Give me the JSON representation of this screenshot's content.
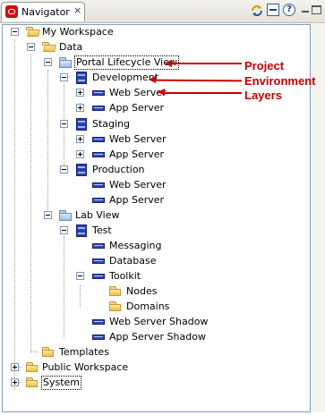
{
  "titlebar": {
    "tab_label": "Navigator",
    "tab_close": "×",
    "help": "?",
    "icons": [
      "navigator-icon",
      "sync-icon",
      "collapse-icon",
      "help-icon",
      "minimize-icon",
      "maximize-icon"
    ]
  },
  "tree": [
    {
      "label": "My Workspace",
      "icon": "folder-open"
    },
    {
      "label": "Data",
      "icon": "folder-open"
    },
    {
      "label": "Portal Lifecycle View",
      "icon": "view-folder"
    },
    {
      "label": "Development",
      "icon": "environment"
    },
    {
      "label": "Web Server",
      "icon": "layer"
    },
    {
      "label": "App Server",
      "icon": "layer"
    },
    {
      "label": "Staging",
      "icon": "environment"
    },
    {
      "label": "Web Server",
      "icon": "layer"
    },
    {
      "label": "App Server",
      "icon": "layer"
    },
    {
      "label": "Production",
      "icon": "environment"
    },
    {
      "label": "Web Server",
      "icon": "layer"
    },
    {
      "label": "App Server",
      "icon": "layer"
    },
    {
      "label": "Lab View",
      "icon": "view-folder"
    },
    {
      "label": "Test",
      "icon": "environment"
    },
    {
      "label": "Messaging",
      "icon": "layer"
    },
    {
      "label": "Database",
      "icon": "layer"
    },
    {
      "label": "Toolkit",
      "icon": "layer"
    },
    {
      "label": "Nodes",
      "icon": "folder"
    },
    {
      "label": "Domains",
      "icon": "folder"
    },
    {
      "label": "Web Server Shadow",
      "icon": "layer"
    },
    {
      "label": "App Server Shadow",
      "icon": "layer"
    },
    {
      "label": "Templates",
      "icon": "folder"
    },
    {
      "label": "Public Workspace",
      "icon": "folder"
    },
    {
      "label": "System",
      "icon": "folder"
    }
  ],
  "annotations": {
    "project": "Project",
    "environment": "Environment",
    "layers": "Layers"
  },
  "colors": {
    "annotation": "#d00000",
    "tree_border": "#7f9db9",
    "environment_icon": "#2a3fae"
  }
}
